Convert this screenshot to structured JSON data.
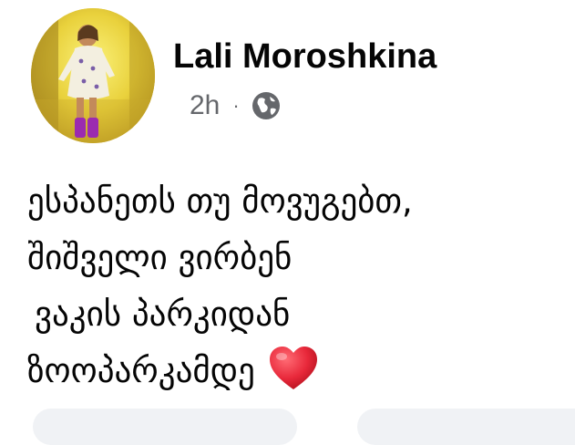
{
  "post": {
    "author": "Lali Moroshkina",
    "time": "2h",
    "separator": "·",
    "privacy_icon": "globe-icon",
    "avatar_icon": "profile-photo",
    "lines": [
      "ესპანეთს თუ მოვუგებთ,",
      "შიშველი ვირბენ",
      "ვაკის პარკიდან",
      "ზოოპარკამდე"
    ],
    "emoji": "heart-emoji",
    "colors": {
      "name": "#050505",
      "meta": "#65676b",
      "heart": "#e8283a",
      "avatar_bg": "#e8d03a"
    }
  }
}
